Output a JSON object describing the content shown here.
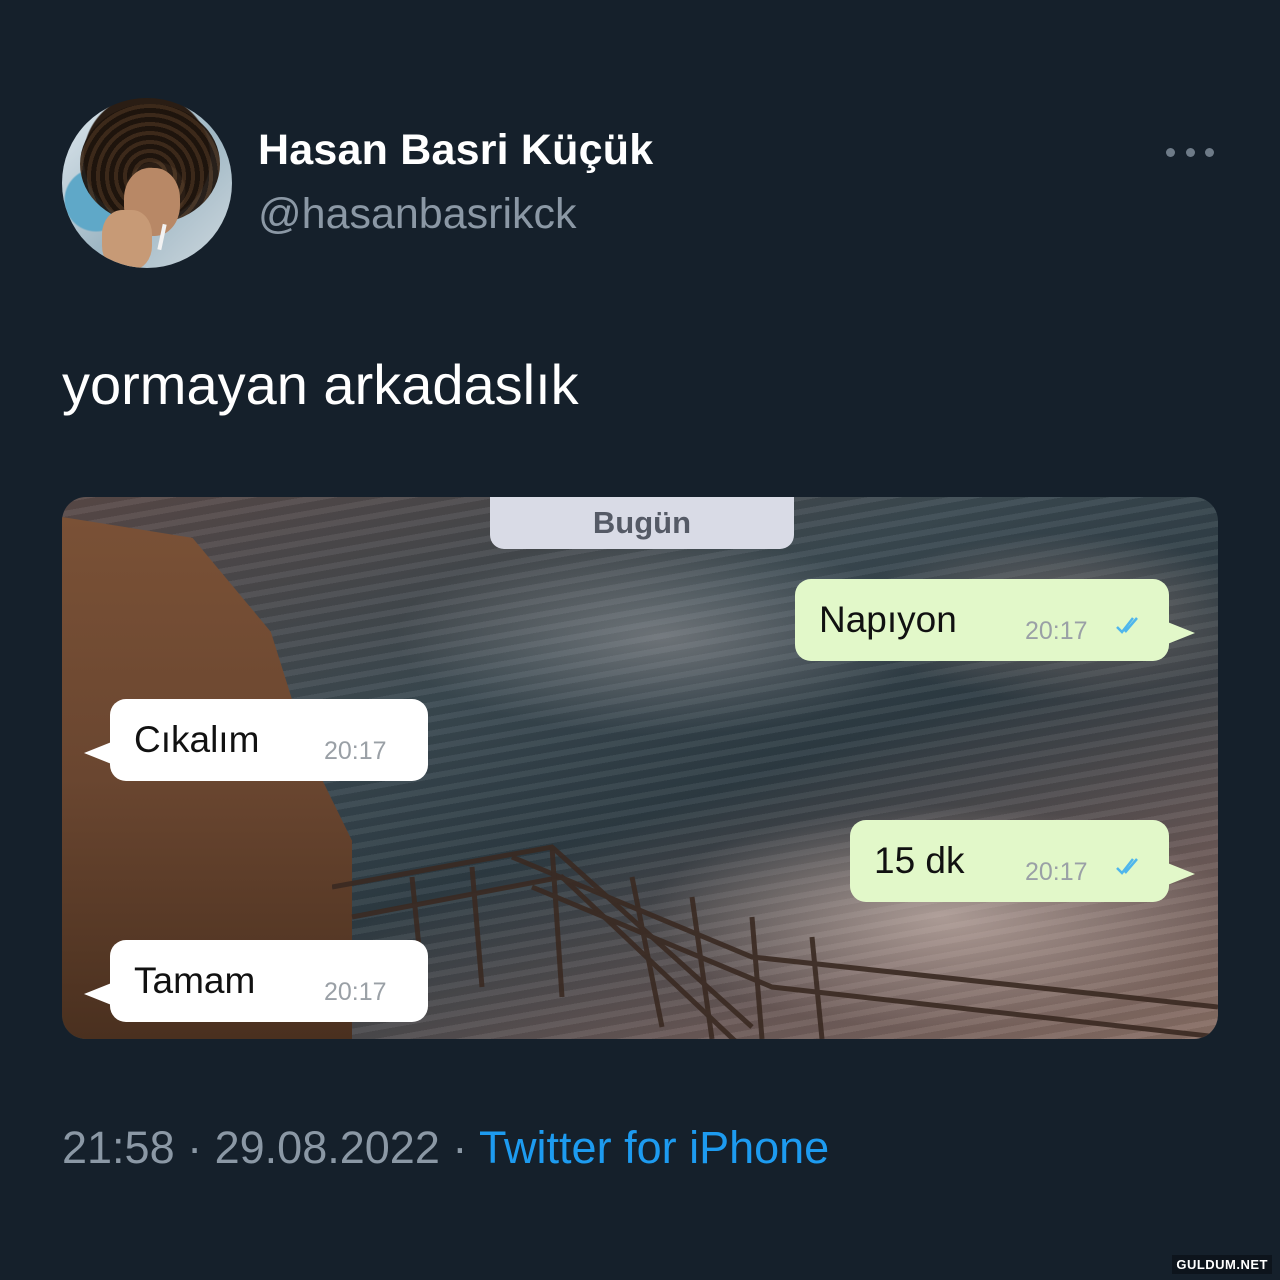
{
  "author": {
    "display_name": "Hasan Basri Küçük",
    "handle": "@hasanbasrikck"
  },
  "icons": {
    "more": "more-horizontal-icon",
    "read_receipt": "double-check-icon",
    "avatar": "profile-photo"
  },
  "tweet": {
    "text": "yormayan arkadaslık"
  },
  "media": {
    "date_chip": "Bugün",
    "messages": [
      {
        "side": "out",
        "text": "Napıyon",
        "time": "20:17"
      },
      {
        "side": "in",
        "text": "Cıkalım",
        "time": "20:17"
      },
      {
        "side": "out",
        "text": "15 dk",
        "time": "20:17"
      },
      {
        "side": "in",
        "text": "Tamam",
        "time": "20:17"
      }
    ]
  },
  "meta": {
    "time": "21:58",
    "separator": " · ",
    "date": "29.08.2022",
    "source": "Twitter for iPhone"
  },
  "watermark": "GULDUM.NET",
  "colors": {
    "background": "#15202b",
    "link": "#1d9bf0",
    "outgoing_bubble": "#e2f8c9",
    "incoming_bubble": "#ffffff",
    "check": "#4fb6ec"
  }
}
